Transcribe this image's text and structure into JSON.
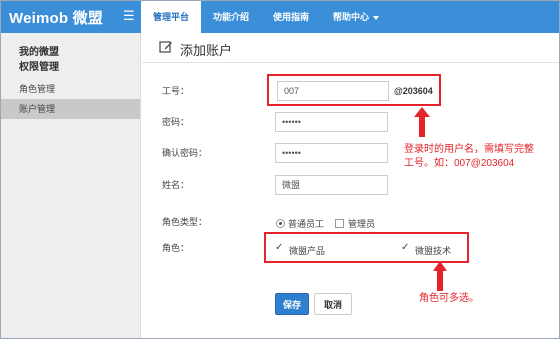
{
  "app": {
    "brand": "Weimob 微盟",
    "menu_icon": "hamburger-icon"
  },
  "nav": {
    "items": [
      {
        "label": "管理平台"
      },
      {
        "label": "功能介绍"
      },
      {
        "label": "使用指南"
      },
      {
        "label": "帮助中心"
      }
    ]
  },
  "sidebar": {
    "heading_line1": "我的微盟",
    "heading_line2": "权限管理",
    "items": [
      {
        "label": "角色管理"
      },
      {
        "label": "账户管理"
      }
    ]
  },
  "page": {
    "title": "添加账户",
    "title_icon": "edit-icon"
  },
  "form": {
    "id_label": "工号：",
    "id_value": "007",
    "id_suffix": "@203604",
    "password_label": "密码：",
    "password_value": "••••••",
    "confirm_label": "确认密码：",
    "confirm_value": "••••••",
    "name_label": "姓名：",
    "name_value": "微盟",
    "role_type_label": "角色类型：",
    "role_type_options": [
      {
        "label": "普通员工",
        "checked": true
      },
      {
        "label": "管理员",
        "checked": false
      }
    ],
    "role_label": "角色：",
    "role_options": [
      {
        "label": "微盟产品",
        "checked": true
      },
      {
        "label": "微盟技术",
        "checked": true
      }
    ],
    "save_label": "保存",
    "cancel_label": "取消"
  },
  "annotations": {
    "id_note_line1": "登录时的用户名，需填写完整",
    "id_note_line2": "工号。如：007@203604",
    "role_note": "角色可多选。"
  },
  "colors": {
    "topbar": "#3a8fd8",
    "annotation": "#e3242b",
    "primary_button": "#2f7fd0"
  }
}
